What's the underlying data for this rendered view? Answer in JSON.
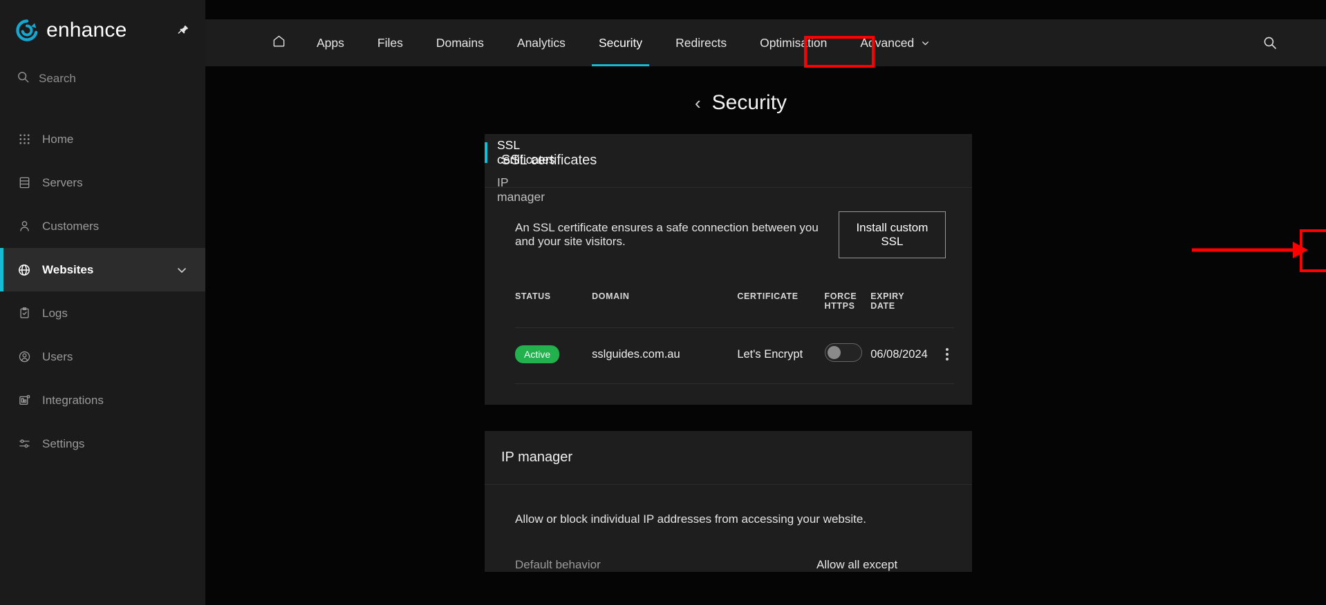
{
  "brand": {
    "name": "enhance",
    "logo_icon": "enhance-e-logo",
    "pin_icon": "pin-icon",
    "accent": "#16bcd4"
  },
  "sidebar": {
    "search": {
      "label": "Search",
      "icon": "search-icon"
    },
    "items": [
      {
        "label": "Home",
        "icon": "grid-dots-icon",
        "active": false,
        "chevron": false
      },
      {
        "label": "Servers",
        "icon": "server-rack-icon",
        "active": false,
        "chevron": false
      },
      {
        "label": "Customers",
        "icon": "person-icon",
        "active": false,
        "chevron": false
      },
      {
        "label": "Websites",
        "icon": "globe-icon",
        "active": true,
        "chevron": true
      },
      {
        "label": "Logs",
        "icon": "clipboard-check-icon",
        "active": false,
        "chevron": false
      },
      {
        "label": "Users",
        "icon": "user-circle-icon",
        "active": false,
        "chevron": false
      },
      {
        "label": "Integrations",
        "icon": "integrations-icon",
        "active": false,
        "chevron": false
      },
      {
        "label": "Settings",
        "icon": "sliders-icon",
        "active": false,
        "chevron": false
      }
    ]
  },
  "topnav": {
    "home_icon": "home-icon",
    "search_icon": "search-icon",
    "tabs": [
      {
        "label": "Apps",
        "selected": false,
        "caret": false
      },
      {
        "label": "Files",
        "selected": false,
        "caret": false
      },
      {
        "label": "Domains",
        "selected": false,
        "caret": false
      },
      {
        "label": "Analytics",
        "selected": false,
        "caret": false
      },
      {
        "label": "Security",
        "selected": true,
        "caret": false
      },
      {
        "label": "Redirects",
        "selected": false,
        "caret": false
      },
      {
        "label": "Optimisation",
        "selected": false,
        "caret": false
      },
      {
        "label": "Advanced",
        "selected": false,
        "caret": true
      }
    ]
  },
  "page": {
    "back_icon": "chevron-left-icon",
    "title": "Security",
    "subnav": [
      {
        "label": "SSL certificates",
        "active": true
      },
      {
        "label": "IP manager",
        "active": false
      }
    ]
  },
  "ssl_card": {
    "title": "SSL certificates",
    "description": "An SSL certificate ensures a safe connection between you and your site visitors.",
    "install_button": "Install custom SSL",
    "columns": [
      "STATUS",
      "DOMAIN",
      "CERTIFICATE",
      "FORCE HTTPS",
      "EXPIRY DATE"
    ],
    "columns_wrapped": {
      "force_line1": "FORCE",
      "force_line2": "HTTPS",
      "expiry_line1": "EXPIRY",
      "expiry_line2": "DATE"
    },
    "rows": [
      {
        "status": "Active",
        "status_color": "#22b14c",
        "domain": "sslguides.com.au",
        "certificate": "Let's Encrypt",
        "force_https": false,
        "expiry_date": "06/08/2024",
        "menu_icon": "kebab-menu-icon"
      }
    ]
  },
  "ip_card": {
    "title": "IP manager",
    "description": "Allow or block individual IP addresses from accessing your website.",
    "default_behavior_label": "Default behavior",
    "default_behavior_value": "Allow all except"
  },
  "annotations": {
    "highlight_color": "#ff0000",
    "security_tab_box": "red-highlight-security-tab",
    "install_button_box": "red-highlight-install-button",
    "arrow": "red-arrow-pointing-right"
  }
}
